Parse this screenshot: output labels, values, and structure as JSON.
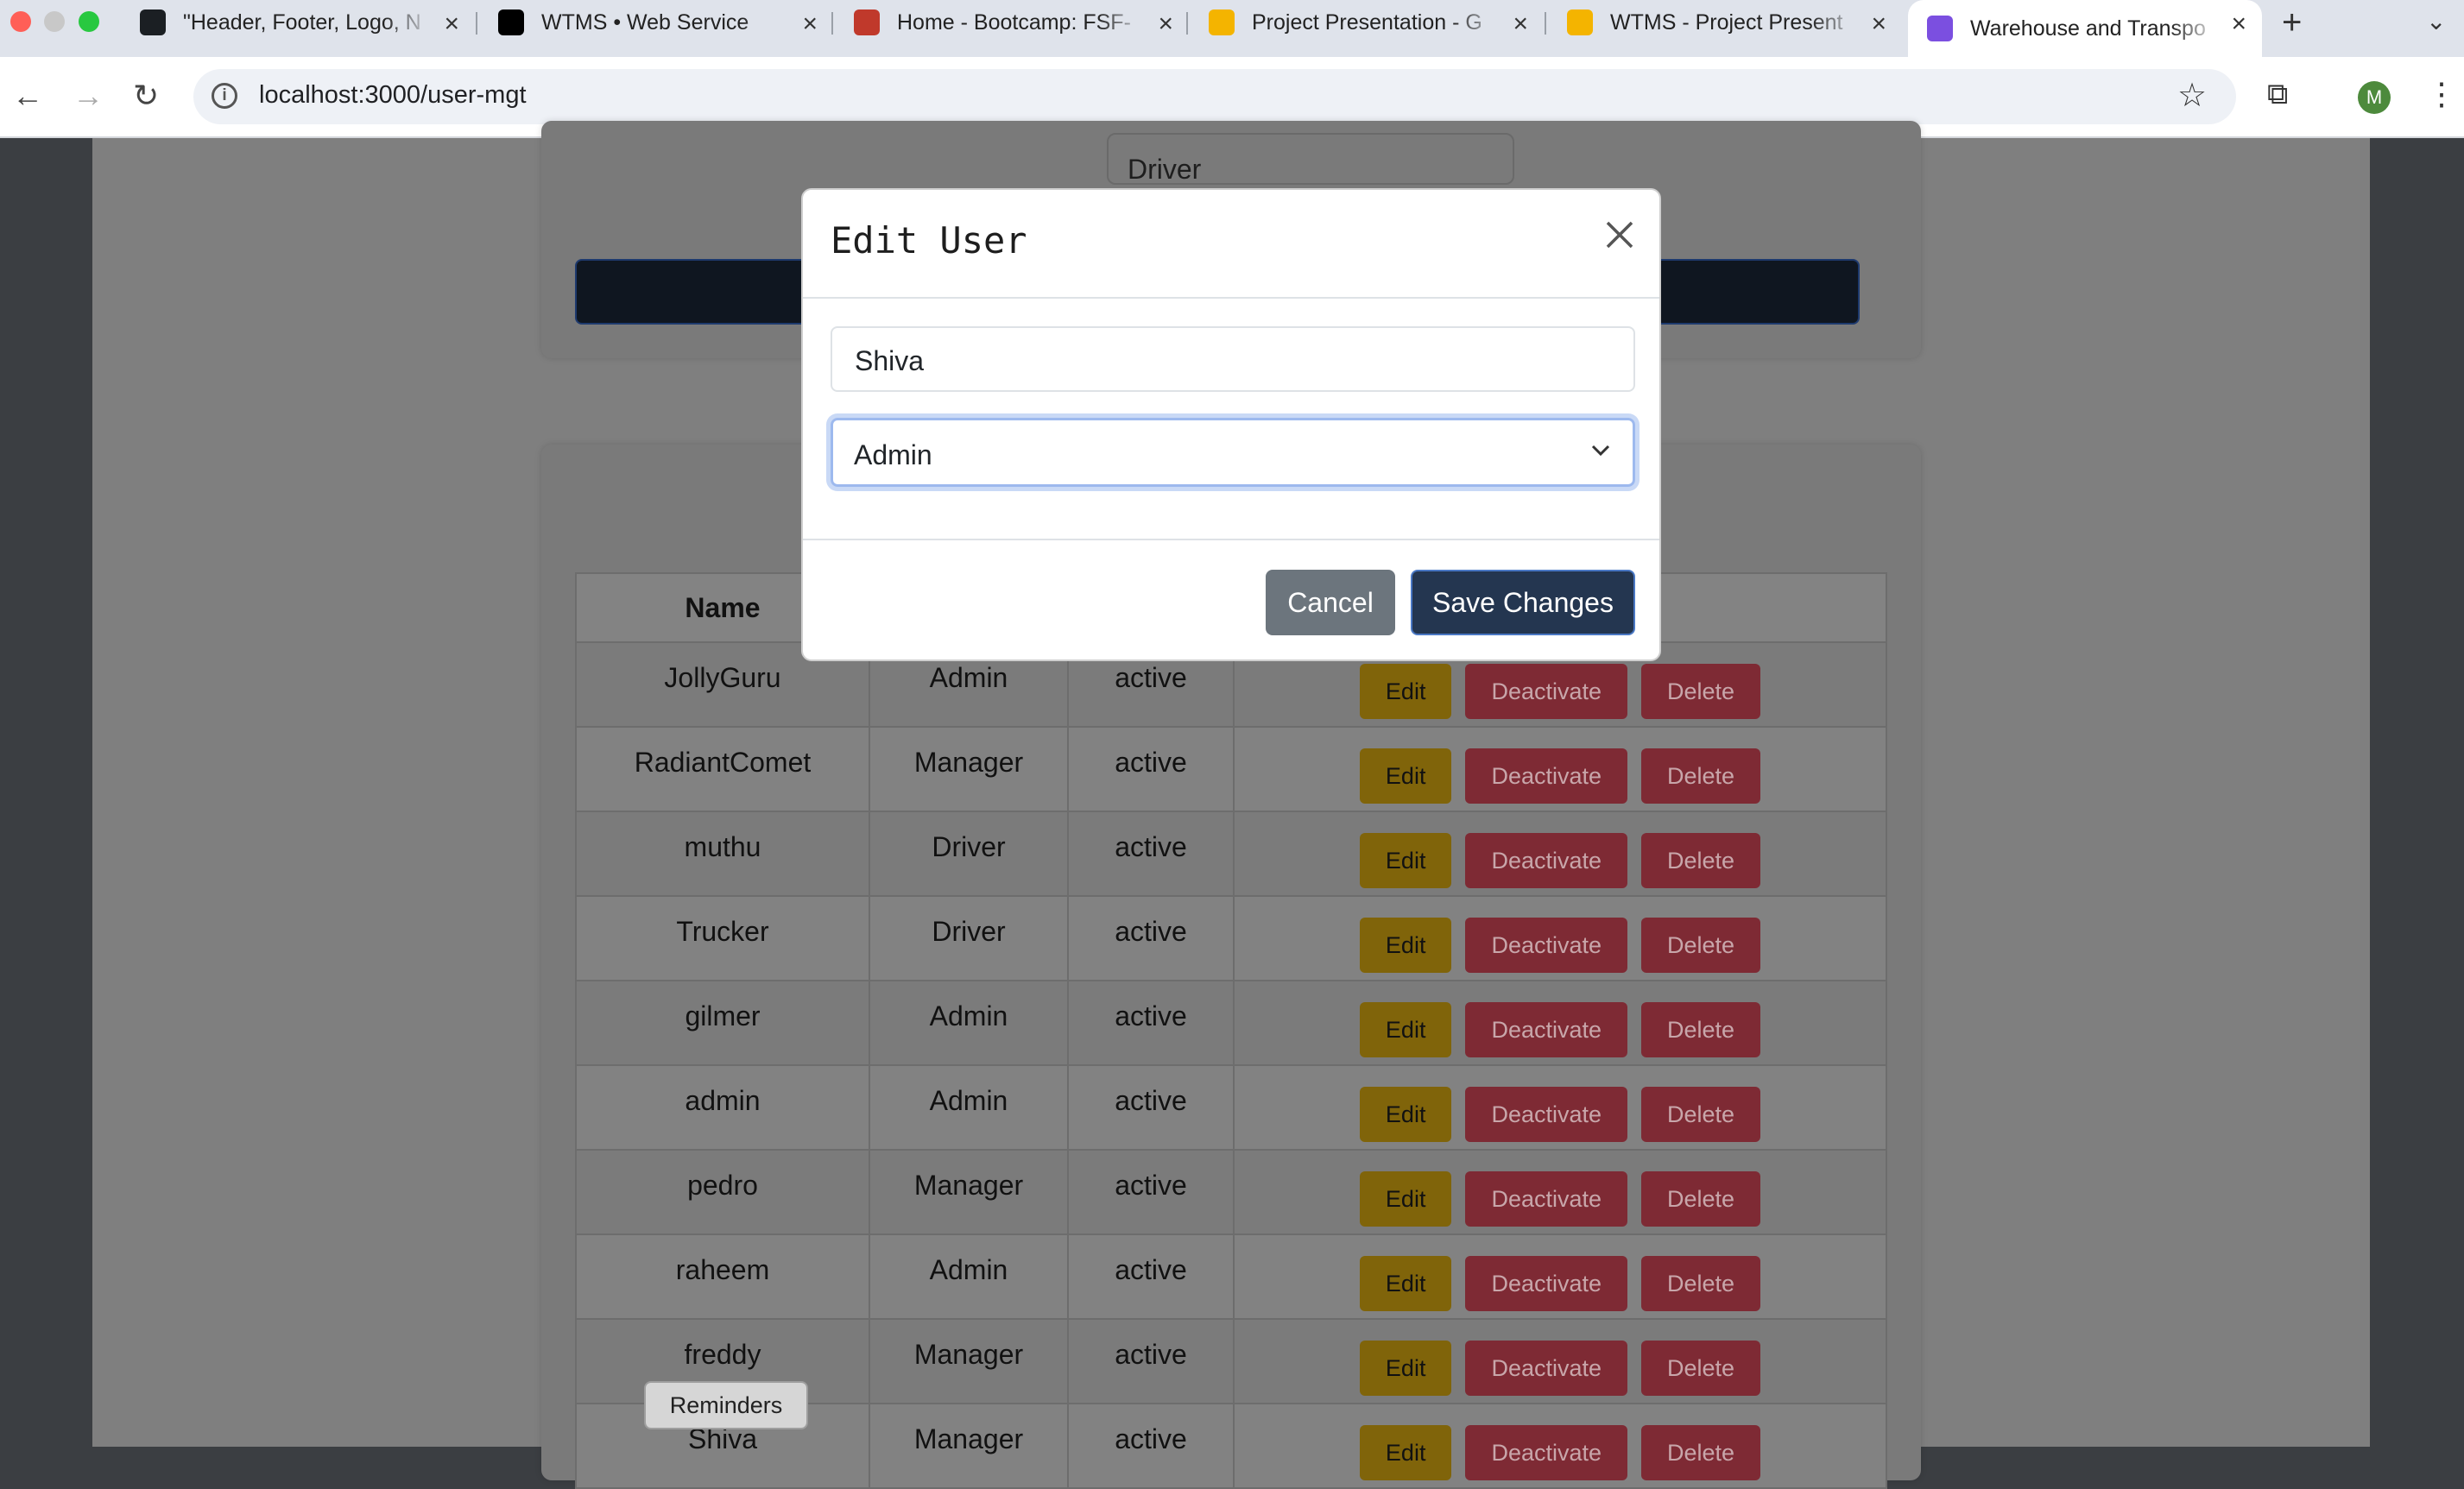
{
  "browser": {
    "tabs": [
      {
        "title": "\"Header, Footer, Logo, N",
        "color": "#1b1f23",
        "icon": "github-icon"
      },
      {
        "title": "WTMS • Web Service",
        "color": "#000000",
        "icon": "render-icon"
      },
      {
        "title": "Home - Bootcamp: FSF-",
        "color": "#c0392b",
        "icon": "bootcamp-icon"
      },
      {
        "title": "Project Presentation - G",
        "color": "#f4b400",
        "icon": "slides-icon"
      },
      {
        "title": "WTMS - Project Present",
        "color": "#f4b400",
        "icon": "slides-icon"
      },
      {
        "title": "Warehouse and Transpo",
        "color": "#7b4fe0",
        "icon": "vite-icon",
        "active": true
      }
    ],
    "url": "localhost:3000/user-mgt",
    "profile_initial": "M"
  },
  "page": {
    "role_filter_value": "Driver",
    "reminders_label": "Reminders"
  },
  "table": {
    "headers": [
      "Name",
      "",
      "",
      ""
    ],
    "actions": {
      "edit": "Edit",
      "deactivate": "Deactivate",
      "delete": "Delete"
    },
    "rows": [
      {
        "name": "JollyGuru",
        "role": "Admin",
        "status": "active"
      },
      {
        "name": "RadiantComet",
        "role": "Manager",
        "status": "active"
      },
      {
        "name": "muthu",
        "role": "Driver",
        "status": "active"
      },
      {
        "name": "Trucker",
        "role": "Driver",
        "status": "active"
      },
      {
        "name": "gilmer",
        "role": "Admin",
        "status": "active"
      },
      {
        "name": "admin",
        "role": "Admin",
        "status": "active"
      },
      {
        "name": "pedro",
        "role": "Manager",
        "status": "active"
      },
      {
        "name": "raheem",
        "role": "Admin",
        "status": "active"
      },
      {
        "name": "freddy",
        "role": "Manager",
        "status": "active"
      },
      {
        "name": "Shiva",
        "role": "Manager",
        "status": "active"
      }
    ]
  },
  "modal": {
    "title": "Edit User",
    "name_value": "Shiva",
    "role_value": "Admin",
    "cancel_label": "Cancel",
    "save_label": "Save Changes"
  }
}
